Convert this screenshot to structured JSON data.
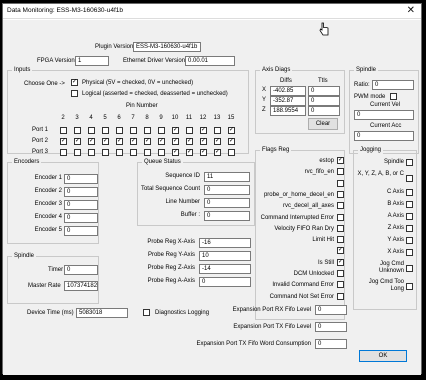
{
  "window": {
    "title": "Data Monitoring: ESS-M3-160630-u4f1b",
    "close_glyph": "✕"
  },
  "top": {
    "plugin_version_label": "Plugin Version",
    "plugin_version_value": "ESS-M3-160630-u4f1b",
    "fpga_version_label": "FPGA Version",
    "fpga_version_value": "1",
    "eth_driver_label": "Ethernet Driver Version",
    "eth_driver_value": "0.00.01"
  },
  "inputs": {
    "group_title": "Inputs",
    "choose_one_label": "Choose One ->",
    "physical_label": "Physical (5V = checked, 0V = unchecked)",
    "logical_label": "Logical (asserted = checked, deasserted = unchecked)",
    "physical_checked": true,
    "logical_checked": false,
    "pin_number_label": "Pin Number",
    "pins": [
      "2",
      "3",
      "4",
      "5",
      "6",
      "7",
      "8",
      "9",
      "10",
      "11",
      "12",
      "13",
      "15"
    ],
    "ports": [
      {
        "label": "Port 1",
        "states": [
          false,
          false,
          false,
          false,
          false,
          false,
          false,
          false,
          true,
          false,
          true,
          false,
          true
        ]
      },
      {
        "label": "Port 2",
        "states": [
          true,
          true,
          true,
          true,
          true,
          true,
          true,
          true,
          true,
          true,
          true,
          true,
          true
        ]
      },
      {
        "label": "Port 3",
        "states": [
          false,
          false,
          false,
          false,
          false,
          false,
          false,
          false,
          true,
          true,
          true,
          true,
          false
        ]
      }
    ]
  },
  "axis_diags": {
    "group_title": "Axis Diags",
    "diffs_header": "Diffs",
    "ttls_header": "Ttls",
    "rows": [
      {
        "axis": "X",
        "diff": "-402.85",
        "ttl": "0"
      },
      {
        "axis": "Y",
        "diff": "-352.87",
        "ttl": "0"
      },
      {
        "axis": "Z",
        "diff": "188.9554",
        "ttl": "0"
      }
    ],
    "clear_label": "Clear"
  },
  "spindle_right": {
    "group_title": "Spindle",
    "ratio_label": "Ratio:",
    "ratio_value": "0",
    "pwm_mode_label": "PWM mode",
    "pwm_mode_checked": false,
    "current_vel_label": "Current Vel",
    "current_vel_value": "0",
    "current_acc_label": "Current Acc",
    "current_acc_value": "0"
  },
  "encoders": {
    "group_title": "Encoders",
    "items": [
      {
        "label": "Encoder 1",
        "value": "0"
      },
      {
        "label": "Encoder 2",
        "value": "0"
      },
      {
        "label": "Encoder 3",
        "value": "0"
      },
      {
        "label": "Encoder 4",
        "value": "0"
      },
      {
        "label": "Encoder 5",
        "value": "0"
      }
    ]
  },
  "queue_status": {
    "group_title": "Queue Status",
    "items": [
      {
        "label": "Sequence ID",
        "value": "11"
      },
      {
        "label": "Total Sequence Count",
        "value": "0"
      },
      {
        "label": "Line Number",
        "value": "0"
      },
      {
        "label": "Buffer :",
        "value": "0"
      }
    ]
  },
  "probe": {
    "items": [
      {
        "label": "Probe Reg X-Axis",
        "value": "-16"
      },
      {
        "label": "Probe Reg Y-Axis",
        "value": "10"
      },
      {
        "label": "Probe Reg Z-Axis",
        "value": "-14"
      },
      {
        "label": "Probe Reg A-Axis",
        "value": "0"
      }
    ]
  },
  "spindle_left": {
    "group_title": "Spindle",
    "timer_label": "Timer",
    "timer_value": "0",
    "master_rate_label": "Master Rate",
    "master_rate_value": "1073741824"
  },
  "flags": {
    "group_title": "Flags Reg",
    "items": [
      {
        "label": "estop",
        "checked": true
      },
      {
        "label": "rvc_fifo_en",
        "checked": false
      },
      {
        "label": "",
        "checked": false
      },
      {
        "label": "probe_or_home_decel_en",
        "checked": false
      },
      {
        "label": "rvc_decel_all_axes",
        "checked": false
      },
      {
        "label": "Command Interrupted Error",
        "checked": false
      },
      {
        "label": "Velocity FIFO Ran Dry",
        "checked": false
      },
      {
        "label": "Limit Hit",
        "checked": false
      },
      {
        "label": "",
        "checked": true
      },
      {
        "label": "Is Still",
        "checked": true
      },
      {
        "label": "DCM Unlocked",
        "checked": false
      },
      {
        "label": "Invalid Command Error",
        "checked": false
      },
      {
        "label": "Command Not Set Error",
        "checked": false
      }
    ]
  },
  "jogging": {
    "group_title": "Jogging",
    "items": [
      {
        "label": "Spindle",
        "checked": false
      },
      {
        "label": "X, Y, Z, A, B, or C",
        "checked": false
      },
      {
        "label": "C Axis",
        "checked": false
      },
      {
        "label": "B Axis",
        "checked": false
      },
      {
        "label": "A Axis",
        "checked": false
      },
      {
        "label": "Z Axis",
        "checked": false
      },
      {
        "label": "Y Axis",
        "checked": false
      },
      {
        "label": "X Axis",
        "checked": false
      },
      {
        "label": "Jog Cmd Unknown",
        "checked": false
      },
      {
        "label": "Jog Cmd Too Long",
        "checked": false
      }
    ]
  },
  "bottom": {
    "device_time_label": "Device Time (ms)",
    "device_time_value": "5083018",
    "diag_logging_label": "Diagnostics Logging",
    "diag_logging_checked": false,
    "rx_fifo_label": "Expansion Port RX Fifo Level",
    "rx_fifo_value": "0",
    "tx_fifo_label": "Expansion Port TX Fifo Level",
    "tx_fifo_value": "0",
    "tx_fifo_word_label": "Expansion Port TX Fifo Word Consumption",
    "tx_fifo_word_value": "0",
    "ok_label": "OK"
  }
}
